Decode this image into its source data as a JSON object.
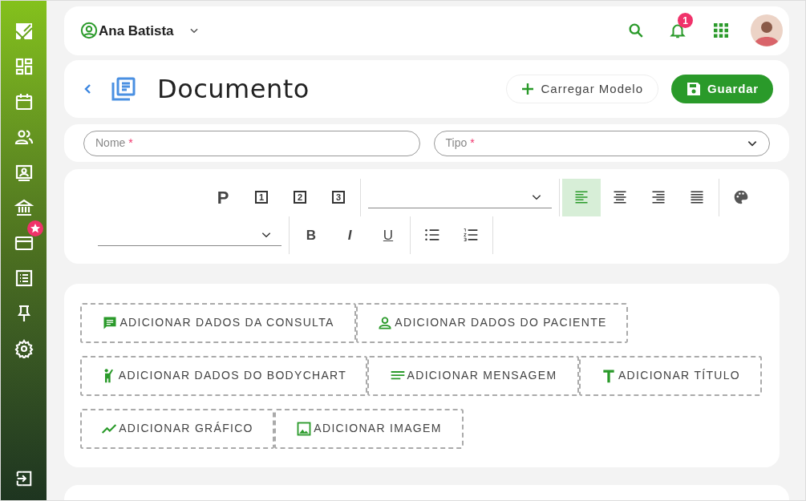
{
  "header": {
    "user_name": "Ana Batista",
    "notifications": "1"
  },
  "page": {
    "title": "Documento",
    "buttons": [
      {
        "label": "Carregar Modelo",
        "kind": "secondary"
      },
      {
        "label": "Guardar",
        "kind": "primary"
      }
    ]
  },
  "fields": [
    {
      "placeholder": "Nome",
      "required_mark": "*",
      "kind": "text"
    },
    {
      "placeholder": "Tipo",
      "required_mark": "*",
      "kind": "select"
    }
  ],
  "toolbar": {
    "blocks": [
      "P",
      "1",
      "2",
      "3"
    ],
    "align": [
      {
        "kind": "left",
        "selected": true
      },
      {
        "kind": "center",
        "selected": false
      },
      {
        "kind": "right",
        "selected": false
      },
      {
        "kind": "justify",
        "selected": false
      }
    ],
    "styles": [
      "B",
      "I",
      "U"
    ]
  },
  "add_buttons": [
    {
      "label": "ADICIONAR DADOS DA CONSULTA",
      "kind": "chat"
    },
    {
      "label": "ADICIONAR DADOS DO PACIENTE",
      "kind": "person"
    },
    {
      "label": "ADICIONAR DADOS DO BODYCHART",
      "kind": "body"
    },
    {
      "label": "ADICIONAR MENSAGEM",
      "kind": "lines"
    },
    {
      "label": "ADICIONAR TÍTULO",
      "kind": "title"
    },
    {
      "label": "ADICIONAR GRÁFICO",
      "kind": "chart"
    },
    {
      "label": "ADICIONAR IMAGEM",
      "kind": "image"
    }
  ]
}
